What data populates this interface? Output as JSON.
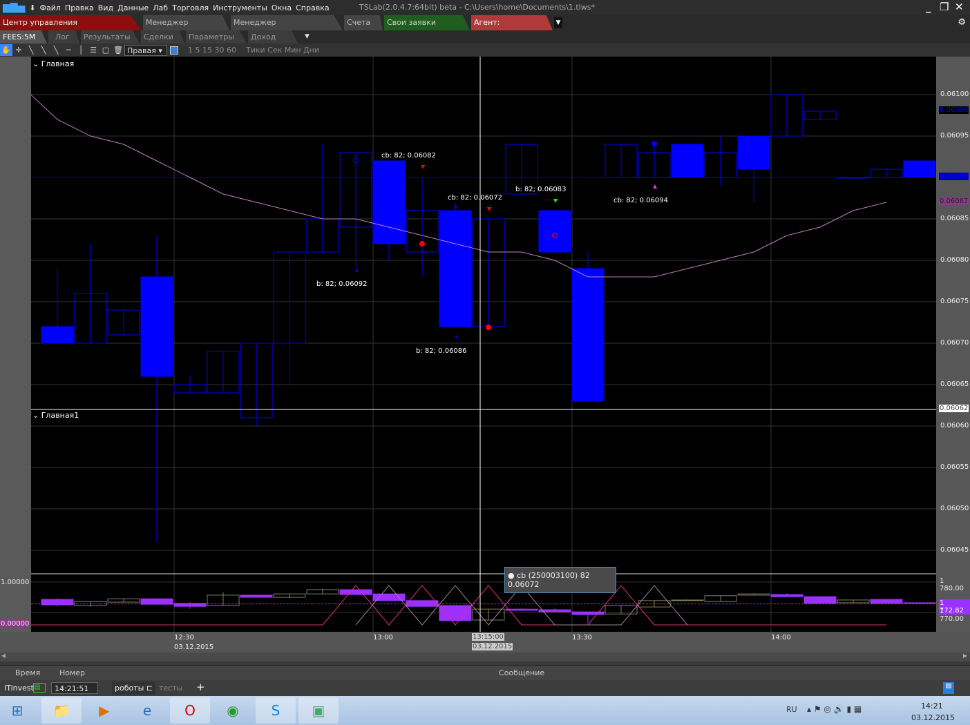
{
  "menu": {
    "items": [
      "Файл",
      "Правка",
      "Вид",
      "Данные",
      "Лаб",
      "Торговля",
      "Инструменты",
      "Окна",
      "Справка"
    ],
    "title": "TSLab(2.0.4.7:64bit) beta - C:\\Users\\home\\Documents\\1.tlws*"
  },
  "tabs_main": [
    {
      "label": "Центр управления алготорговлей",
      "color": "#8b0f0f"
    },
    {
      "label": "Менеджер команд",
      "color": "#444444"
    },
    {
      "label": "Менеджер подключений",
      "color": "#444444"
    },
    {
      "label": "Счета",
      "color": "#444444"
    },
    {
      "label": "Свои заявки (6845)",
      "color": "#1f5e1f"
    },
    {
      "label": "Агент: донабор4",
      "color": "#b03a3a"
    }
  ],
  "tabs_sub": [
    "FEES:5M",
    "Лог",
    "Результаты",
    "Сделки",
    "Параметры",
    "Доход"
  ],
  "toolbar": {
    "axis_select": "Правая",
    "intervals": "1 5 15 30 60",
    "units": "Тики Сек Мин Дни"
  },
  "panes": {
    "main": "Главная",
    "second": "Главная1"
  },
  "annotations": [
    "cb: 82; 0.06082",
    "cb: 82; 0.06072",
    "b: 82; 0.06083",
    "cb: 82; 0.06094",
    "b: 82; 0.06092",
    "b: 82; 0.06086"
  ],
  "tooltip": "cb (250003100) 82 0.06072",
  "crosshair": {
    "time": "13:15:00",
    "date": "03.12.2015",
    "price": "0.06062"
  },
  "price_badges": {
    "last": "0.06098",
    "level": "0.06090",
    "ma": "0.06087",
    "ind_level": "1 772.82",
    "ind_max": "1.00000",
    "ind_min": "0.00000"
  },
  "chart_data": [
    {
      "type": "candlestick",
      "title": "FEES:5M",
      "start_time": "12:10",
      "interval_min": 5,
      "yaxis_ticks": [
        "0.06100",
        "0.06095",
        "0.06090",
        "0.06085",
        "0.06080",
        "0.06075",
        "0.06070",
        "0.06065",
        "0.06060",
        "0.06055",
        "0.06050",
        "0.06045"
      ],
      "ylim": [
        0.06038,
        0.06106
      ],
      "ohlc": [
        [
          0.06072,
          0.06079,
          0.0607,
          0.0607
        ],
        [
          0.0607,
          0.06082,
          0.0607,
          0.06076
        ],
        [
          0.06071,
          0.06074,
          0.06071,
          0.06074
        ],
        [
          0.06078,
          0.06083,
          0.06046,
          0.06066
        ],
        [
          0.06064,
          0.06066,
          0.06064,
          0.06065
        ],
        [
          0.06064,
          0.06069,
          0.06064,
          0.06069
        ],
        [
          0.06061,
          0.0607,
          0.0606,
          0.0607
        ],
        [
          0.0607,
          0.06081,
          0.06065,
          0.06081
        ],
        [
          0.06081,
          0.06094,
          0.06081,
          0.06085
        ],
        [
          0.06084,
          0.06093,
          0.06079,
          0.06093
        ],
        [
          0.06092,
          0.06092,
          0.0608,
          0.06082
        ],
        [
          0.06081,
          0.0609,
          0.06078,
          0.06086
        ],
        [
          0.06086,
          0.06087,
          0.06072,
          0.06072
        ],
        [
          0.06072,
          0.06085,
          0.06072,
          0.06085
        ],
        [
          0.06088,
          0.06094,
          0.06088,
          0.06094
        ],
        [
          0.06086,
          0.06086,
          0.06081,
          0.06081
        ],
        [
          0.06079,
          0.06081,
          0.06063,
          0.06063
        ],
        [
          0.0609,
          0.06094,
          0.0609,
          0.06094
        ],
        [
          0.0609,
          0.06094,
          0.0609,
          0.06093
        ],
        [
          0.06094,
          0.06094,
          0.0609,
          0.0609
        ],
        [
          0.0609,
          0.06095,
          0.06089,
          0.06093
        ],
        [
          0.06095,
          0.06095,
          0.06087,
          0.06091
        ],
        [
          0.06095,
          0.061,
          0.06095,
          0.061
        ],
        [
          0.06097,
          0.06098,
          0.06097,
          0.06098
        ],
        [
          0.0609,
          0.0609,
          0.0609,
          0.0609
        ],
        [
          0.0609,
          0.06091,
          0.0609,
          0.06091
        ],
        [
          0.06092,
          0.06092,
          0.0609,
          0.0609
        ]
      ],
      "ma": [
        [
          -0.8,
          0.061
        ],
        [
          0,
          0.06097
        ],
        [
          1,
          0.06095
        ],
        [
          2,
          0.06094
        ],
        [
          3,
          0.06092
        ],
        [
          4,
          0.0609
        ],
        [
          5,
          0.06088
        ],
        [
          6,
          0.06087
        ],
        [
          7,
          0.06086
        ],
        [
          8,
          0.06085
        ],
        [
          9,
          0.06085
        ],
        [
          10,
          0.06084
        ],
        [
          11,
          0.06083
        ],
        [
          12,
          0.06082
        ],
        [
          13,
          0.06081
        ],
        [
          14,
          0.06081
        ],
        [
          15,
          0.0608
        ],
        [
          16,
          0.06078
        ],
        [
          17,
          0.06078
        ],
        [
          18,
          0.06078
        ],
        [
          19,
          0.06079
        ],
        [
          20,
          0.0608
        ],
        [
          21,
          0.06081
        ],
        [
          22,
          0.06083
        ],
        [
          23,
          0.06084
        ],
        [
          24,
          0.06086
        ],
        [
          25,
          0.06087
        ]
      ],
      "level": 0.0609,
      "crosshair_price": 0.06062,
      "colors": {
        "candle": "#0000ff",
        "ma": "#c080c0",
        "grid": "#333333"
      }
    },
    {
      "type": "candlestick",
      "title": "indicator",
      "yaxis_ticks": [
        "1 780.00",
        "1 770.00"
      ],
      "ylim": [
        1765,
        1782
      ],
      "level": 1772.82,
      "ohlc": [
        [
          1774.3,
          1774.6,
          1772.0,
          1772.5
        ],
        [
          1772.3,
          1773.6,
          1771.8,
          1773.6
        ],
        [
          1773.4,
          1774.5,
          1773.4,
          1774.5
        ],
        [
          1774.5,
          1774.7,
          1772.7,
          1772.7
        ],
        [
          1773.0,
          1773.4,
          1771.2,
          1772.0
        ],
        [
          1772.3,
          1776.6,
          1772.3,
          1775.7
        ],
        [
          1775.7,
          1775.9,
          1775.0,
          1775.0
        ],
        [
          1775.0,
          1776.1,
          1774.6,
          1776.1
        ],
        [
          1776.1,
          1777.9,
          1776.1,
          1777.5
        ],
        [
          1777.5,
          1777.5,
          1775.9,
          1775.9
        ],
        [
          1776.1,
          1776.1,
          1773.9,
          1773.9
        ],
        [
          1773.9,
          1773.9,
          1772.0,
          1772.0
        ],
        [
          1772.3,
          1772.3,
          1767.3,
          1767.3
        ],
        [
          1767.5,
          1771.1,
          1767.5,
          1771.1
        ],
        [
          1771.1,
          1771.3,
          1770.7,
          1770.7
        ],
        [
          1770.9,
          1771.3,
          1770.2,
          1770.2
        ],
        [
          1770.2,
          1770.2,
          1766.4,
          1769.3
        ],
        [
          1769.5,
          1772.3,
          1769.5,
          1772.3
        ],
        [
          1771.8,
          1773.9,
          1771.8,
          1773.9
        ],
        [
          1773.9,
          1774.3,
          1773.9,
          1774.1
        ],
        [
          1773.6,
          1775.5,
          1773.6,
          1775.5
        ],
        [
          1775.7,
          1776.3,
          1775.7,
          1776.1
        ],
        [
          1775.9,
          1776.3,
          1775.2,
          1775.2
        ],
        [
          1775.2,
          1775.2,
          1773.0,
          1773.0
        ],
        [
          1773.2,
          1774.1,
          1773.2,
          1774.1
        ],
        [
          1774.3,
          1774.3,
          1773.0,
          1773.0
        ],
        [
          1773.2,
          1773.2,
          1773.0,
          1773.0
        ]
      ],
      "zigzag_pink": [
        [
          -0.8,
          0
        ],
        [
          8,
          0
        ],
        [
          9,
          1
        ],
        [
          10,
          0
        ],
        [
          11,
          1
        ],
        [
          12,
          0
        ],
        [
          13,
          1
        ],
        [
          14,
          0
        ],
        [
          16,
          0
        ],
        [
          17,
          1
        ],
        [
          18,
          0
        ],
        [
          25,
          0
        ]
      ],
      "zigzag_grey": [
        [
          9,
          0
        ],
        [
          10,
          1
        ],
        [
          11,
          0
        ],
        [
          12,
          1
        ],
        [
          13,
          0
        ],
        [
          14,
          1
        ],
        [
          15,
          0
        ],
        [
          17,
          0
        ],
        [
          18,
          1
        ],
        [
          19,
          0
        ]
      ],
      "colors": {
        "up": "#808060",
        "down": "#9b30ff",
        "pink": "#e0307a",
        "grey": "#a080a0"
      }
    }
  ],
  "time_axis": [
    {
      "time": "12:30",
      "date": "03.12.2015"
    },
    {
      "time": "13:00"
    },
    {
      "time": "13:30"
    },
    {
      "time": "14:00"
    }
  ],
  "log": {
    "columns": [
      "Время",
      "Номер",
      "Сообщение"
    ]
  },
  "statusbar": {
    "broker": "ITinvest",
    "clock": "14:21:51",
    "tabs": [
      "роботы",
      "тесты"
    ],
    "add": "+"
  },
  "taskbar": {
    "lang": "RU",
    "time": "14:21",
    "date": "03.12.2015"
  }
}
